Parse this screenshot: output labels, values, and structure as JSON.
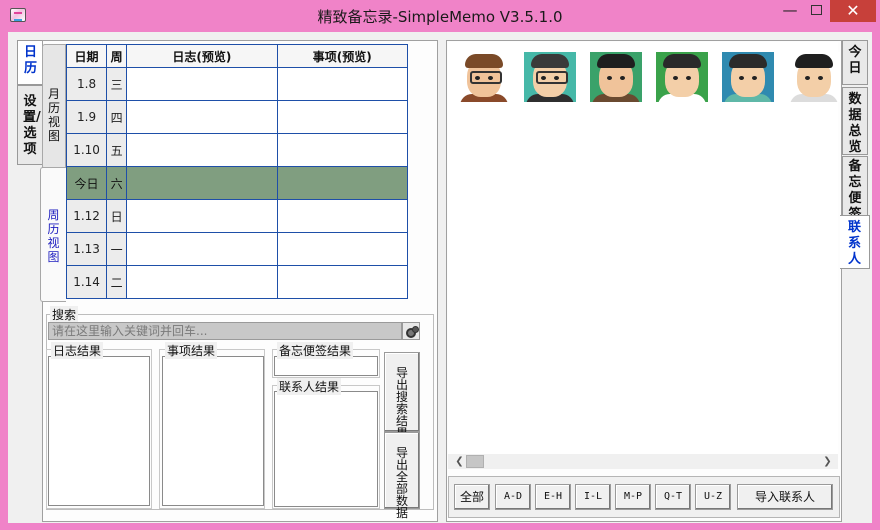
{
  "window": {
    "title": "精致备忘录-SimpleMemo V3.5.1.0",
    "minimize": "—",
    "close": "✕"
  },
  "left_tabs": {
    "calendar": "日历",
    "settings": "设置/选项"
  },
  "view_tabs": {
    "month": "月历视图",
    "week": "周历视图"
  },
  "week_table": {
    "headers": [
      "日期",
      "周",
      "日志(预览)",
      "事项(预览)"
    ],
    "rows": [
      {
        "date": "1.8",
        "weekday": "三",
        "diary": "",
        "item": ""
      },
      {
        "date": "1.9",
        "weekday": "四",
        "diary": "",
        "item": ""
      },
      {
        "date": "1.10",
        "weekday": "五",
        "diary": "",
        "item": ""
      },
      {
        "date": "今日",
        "weekday": "六",
        "diary": "",
        "item": "",
        "today": true
      },
      {
        "date": "1.12",
        "weekday": "日",
        "diary": "",
        "item": ""
      },
      {
        "date": "1.13",
        "weekday": "一",
        "diary": "",
        "item": ""
      },
      {
        "date": "1.14",
        "weekday": "二",
        "diary": "",
        "item": ""
      }
    ]
  },
  "search": {
    "label": "搜索",
    "placeholder": "请在这里输入关键词并回车...",
    "value": "",
    "search_icon": "binoculars-icon"
  },
  "results": {
    "diary": "日志结果",
    "items": "事项结果",
    "memos": "备忘便签结果",
    "contacts": "联系人结果"
  },
  "buttons": {
    "export_search": "导出搜索结果",
    "export_all": "导出全部数据"
  },
  "contacts_panel": {
    "avatars": [
      {
        "name": "avatar-1",
        "hair": "#7a4a28",
        "skin": "#f0c39a",
        "shirt": "#8a4a2a",
        "bg": "#ffffff",
        "glasses": true
      },
      {
        "name": "avatar-2",
        "hair": "#3a3a3a",
        "skin": "#f3cfa8",
        "shirt": "#2f2f2f",
        "bg": "#46b8a8",
        "glasses": true
      },
      {
        "name": "avatar-3",
        "hair": "#1f1f1f",
        "skin": "#f0c39a",
        "shirt": "#6a4a30",
        "bg": "#3aa26a",
        "glasses": false
      },
      {
        "name": "avatar-4",
        "hair": "#2a2a2a",
        "skin": "#f3cfa8",
        "shirt": "#ffffff",
        "bg": "#3aa24a",
        "glasses": false
      },
      {
        "name": "avatar-5",
        "hair": "#2b2b2b",
        "skin": "#f3cfa8",
        "shirt": "#5fb8a8",
        "bg": "#2f8ab0",
        "glasses": false
      },
      {
        "name": "avatar-6",
        "hair": "#1f1f1f",
        "skin": "#f3cfa8",
        "shirt": "#dcdcdc",
        "bg": "#ffffff",
        "glasses": false
      }
    ],
    "filters": [
      "全部",
      "A-D",
      "E-H",
      "I-L",
      "M-P",
      "Q-T",
      "U-Z"
    ],
    "import": "导入联系人"
  },
  "right_tabs": {
    "today": "今日",
    "data_overview": "数据总览",
    "memo_notes": "备忘便签",
    "contacts": "联系人"
  },
  "colors": {
    "title_bar": "#f083c8",
    "today_row": "#809e80",
    "grid_line": "#1e4fa8",
    "active_tab_text": "#0033cc"
  }
}
